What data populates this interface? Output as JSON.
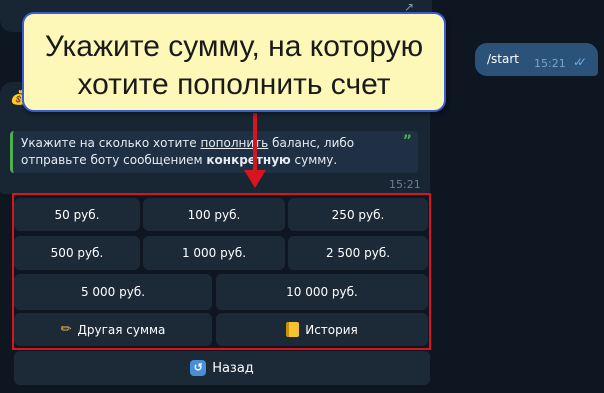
{
  "outgoing_message": {
    "text": "/start",
    "time": "15:21",
    "status_icon": "double-check-icon"
  },
  "incoming_message": {
    "icon": "money-bag-icon",
    "quote_part1": "Укажите на сколько хотите ",
    "quote_underlined": "пополнить",
    "quote_part2": " баланс, либо отправьте боту сообщением ",
    "quote_bold": "конкретную",
    "quote_part3": " сумму.",
    "time": "15:21"
  },
  "keyboard": {
    "rows": [
      [
        "50 руб.",
        "100 руб.",
        "250 руб."
      ],
      [
        "500 руб.",
        "1 000 руб.",
        "2 500 руб."
      ],
      [
        "5 000 руб.",
        "10 000 руб."
      ],
      [
        "Другая сумма",
        "История"
      ]
    ],
    "back_label": "Назад"
  },
  "callout": {
    "line1": "Укажите сумму, на которую",
    "line2": "хотите пополнить счет"
  },
  "colors": {
    "background": "#0e1621",
    "bubble": "#182533",
    "outgoing_bubble": "#2b5278",
    "highlight_red": "#d8141e",
    "callout_fill": "#fdf8b8",
    "callout_border": "#3b5bd6"
  }
}
